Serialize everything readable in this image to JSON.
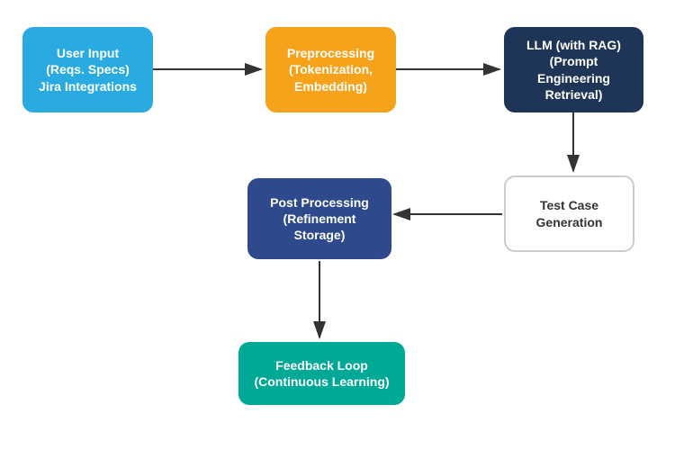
{
  "nodes": {
    "user_input": {
      "label": "User Input\n(Reqs. Specs)\nJira Integrations",
      "line1": "User Input",
      "line2": "(Reqs. Specs)",
      "line3": "Jira Integrations",
      "color": "#29ABE2"
    },
    "preprocessing": {
      "label": "Preprocessing\n(Tokenization,\nEmbedding)",
      "line1": "Preprocessing",
      "line2": "(Tokenization,",
      "line3": "Embedding)",
      "color": "#F7A21B"
    },
    "llm": {
      "label": "LLM (with RAG)\n(Prompt Engineering\nRetrieval)",
      "line1": "LLM (with RAG)",
      "line2": "(Prompt Engineering",
      "line3": "Retrieval)",
      "color": "#1F3557"
    },
    "test_case": {
      "label": "Test Case\nGeneration",
      "line1": "Test Case",
      "line2": "Generation",
      "color": "#ffffff"
    },
    "post_processing": {
      "label": "Post Processing\n(Refinement Storage)",
      "line1": "Post Processing",
      "line2": "(Refinement Storage)",
      "color": "#2E4A8C"
    },
    "feedback_loop": {
      "label": "Feedback Loop\n(Continuous Learning)",
      "line1": "Feedback Loop",
      "line2": "(Continuous Learning)",
      "color": "#00A896"
    }
  }
}
